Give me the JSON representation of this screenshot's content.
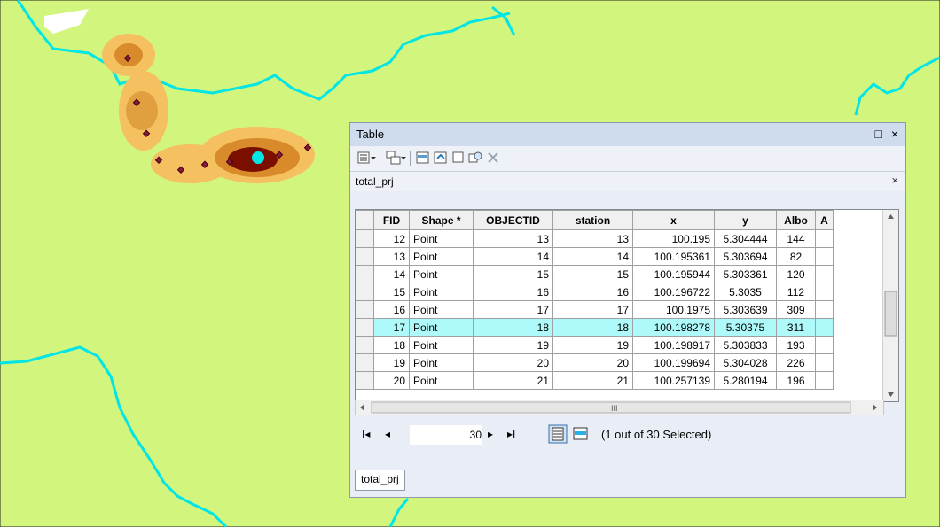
{
  "window": {
    "title": "Table",
    "restore_label": "□",
    "close_label": "×"
  },
  "toolbar": {
    "table_options_icon": "table-options-icon",
    "related_tables_icon": "related-tables-icon",
    "select_by_attributes_icon": "select-by-attributes-icon",
    "switch_selection_icon": "switch-selection-icon",
    "clear_selection_icon": "clear-selection-icon",
    "zoom_to_selected_icon": "zoom-to-selected-icon",
    "delete_selected_icon": "delete-selected-icon"
  },
  "subtable": {
    "name": "total_prj",
    "close_label": "×"
  },
  "columns": [
    "FID",
    "Shape *",
    "OBJECTID",
    "station",
    "x",
    "y",
    "Albo",
    "A"
  ],
  "rows": [
    {
      "fid": "12",
      "shape": "Point",
      "objectid": "13",
      "station": "13",
      "x": "100.195",
      "y": "5.304444",
      "albo": "144"
    },
    {
      "fid": "13",
      "shape": "Point",
      "objectid": "14",
      "station": "14",
      "x": "100.195361",
      "y": "5.303694",
      "albo": "82"
    },
    {
      "fid": "14",
      "shape": "Point",
      "objectid": "15",
      "station": "15",
      "x": "100.195944",
      "y": "5.303361",
      "albo": "120"
    },
    {
      "fid": "15",
      "shape": "Point",
      "objectid": "16",
      "station": "16",
      "x": "100.196722",
      "y": "5.3035",
      "albo": "112"
    },
    {
      "fid": "16",
      "shape": "Point",
      "objectid": "17",
      "station": "17",
      "x": "100.1975",
      "y": "5.303639",
      "albo": "309"
    },
    {
      "fid": "17",
      "shape": "Point",
      "objectid": "18",
      "station": "18",
      "x": "100.198278",
      "y": "5.30375",
      "albo": "311"
    },
    {
      "fid": "18",
      "shape": "Point",
      "objectid": "19",
      "station": "19",
      "x": "100.198917",
      "y": "5.303833",
      "albo": "193"
    },
    {
      "fid": "19",
      "shape": "Point",
      "objectid": "20",
      "station": "20",
      "x": "100.199694",
      "y": "5.304028",
      "albo": "226"
    },
    {
      "fid": "20",
      "shape": "Point",
      "objectid": "21",
      "station": "21",
      "x": "100.257139",
      "y": "5.280194",
      "albo": "196"
    }
  ],
  "hscroll_thumb_label": "III",
  "navigation": {
    "first_label": "I◂",
    "prev_label": "◂",
    "record_value": "30",
    "next_label": "▸",
    "last_label": "▸I",
    "status": "(1 out of 30 Selected)"
  },
  "tab_label": "total_prj",
  "colors": {
    "map_background": "#d2f57d",
    "river": "#00e5e5",
    "selected_row": "#aef9f9",
    "hotspot_dark": "#7a0f00",
    "hotspot_mid": "#d98a2a",
    "hotspot_light": "#f5c060"
  }
}
